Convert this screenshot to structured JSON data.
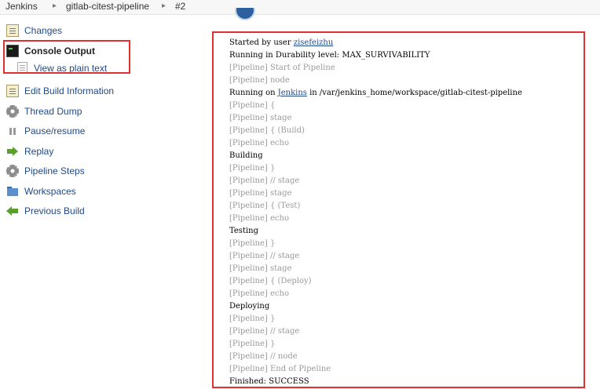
{
  "breadcrumb": {
    "items": [
      "Jenkins",
      "gitlab-citest-pipeline",
      "#2"
    ],
    "separator": "▸"
  },
  "sidebar": {
    "items": [
      {
        "label": "Changes",
        "icon": "notepad-icon"
      },
      {
        "label": "Console Output",
        "icon": "terminal-icon",
        "active": true
      },
      {
        "label": "View as plain text",
        "icon": "document-icon",
        "sub": true
      },
      {
        "label": "Edit Build Information",
        "icon": "notepad-icon"
      },
      {
        "label": "Thread Dump",
        "icon": "gear-icon"
      },
      {
        "label": "Pause/resume",
        "icon": "pause-icon"
      },
      {
        "label": "Replay",
        "icon": "replay-arrow-icon"
      },
      {
        "label": "Pipeline Steps",
        "icon": "gear-icon"
      },
      {
        "label": "Workspaces",
        "icon": "folder-icon"
      },
      {
        "label": "Previous Build",
        "icon": "back-arrow-icon"
      }
    ]
  },
  "console": {
    "lines": [
      {
        "parts": [
          {
            "t": "Started by user "
          },
          {
            "t": "zisefeizhu",
            "link": true
          }
        ]
      },
      {
        "parts": [
          {
            "t": "Running in Durability level: MAX_SURVIVABILITY"
          }
        ]
      },
      {
        "pipeline": true,
        "parts": [
          {
            "t": "[Pipeline] Start of Pipeline"
          }
        ]
      },
      {
        "pipeline": true,
        "parts": [
          {
            "t": "[Pipeline] node"
          }
        ]
      },
      {
        "parts": [
          {
            "t": "Running on "
          },
          {
            "t": "Jenkins",
            "link": true
          },
          {
            "t": " in /var/jenkins_home/workspace/gitlab-citest-pipeline"
          }
        ]
      },
      {
        "pipeline": true,
        "parts": [
          {
            "t": "[Pipeline] {"
          }
        ]
      },
      {
        "pipeline": true,
        "parts": [
          {
            "t": "[Pipeline] stage"
          }
        ]
      },
      {
        "pipeline": true,
        "parts": [
          {
            "t": "[Pipeline] { (Build)"
          }
        ]
      },
      {
        "pipeline": true,
        "parts": [
          {
            "t": "[Pipeline] echo"
          }
        ]
      },
      {
        "parts": [
          {
            "t": "Building"
          }
        ]
      },
      {
        "pipeline": true,
        "parts": [
          {
            "t": "[Pipeline] }"
          }
        ]
      },
      {
        "pipeline": true,
        "parts": [
          {
            "t": "[Pipeline] // stage"
          }
        ]
      },
      {
        "pipeline": true,
        "parts": [
          {
            "t": "[Pipeline] stage"
          }
        ]
      },
      {
        "pipeline": true,
        "parts": [
          {
            "t": "[Pipeline] { (Test)"
          }
        ]
      },
      {
        "pipeline": true,
        "parts": [
          {
            "t": "[Pipeline] echo"
          }
        ]
      },
      {
        "parts": [
          {
            "t": "Testing"
          }
        ]
      },
      {
        "pipeline": true,
        "parts": [
          {
            "t": "[Pipeline] }"
          }
        ]
      },
      {
        "pipeline": true,
        "parts": [
          {
            "t": "[Pipeline] // stage"
          }
        ]
      },
      {
        "pipeline": true,
        "parts": [
          {
            "t": "[Pipeline] stage"
          }
        ]
      },
      {
        "pipeline": true,
        "parts": [
          {
            "t": "[Pipeline] { (Deploy)"
          }
        ]
      },
      {
        "pipeline": true,
        "parts": [
          {
            "t": "[Pipeline] echo"
          }
        ]
      },
      {
        "parts": [
          {
            "t": "Deploying"
          }
        ]
      },
      {
        "pipeline": true,
        "parts": [
          {
            "t": "[Pipeline] }"
          }
        ]
      },
      {
        "pipeline": true,
        "parts": [
          {
            "t": "[Pipeline] // stage"
          }
        ]
      },
      {
        "pipeline": true,
        "parts": [
          {
            "t": "[Pipeline] }"
          }
        ]
      },
      {
        "pipeline": true,
        "parts": [
          {
            "t": "[Pipeline] // node"
          }
        ]
      },
      {
        "pipeline": true,
        "parts": [
          {
            "t": "[Pipeline] End of Pipeline"
          }
        ]
      },
      {
        "parts": [
          {
            "t": "Finished: SUCCESS"
          }
        ]
      }
    ]
  },
  "colors": {
    "highlight": "#e03030",
    "link": "#204a87",
    "pipeline_text": "#9a9a9a"
  }
}
